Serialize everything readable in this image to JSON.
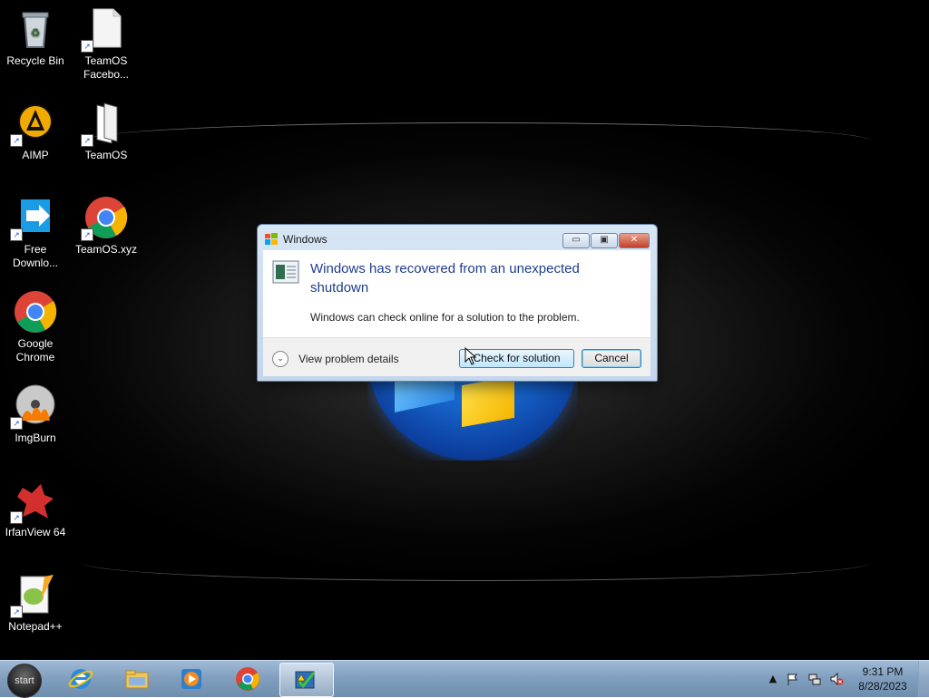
{
  "desktop": {
    "icons": [
      {
        "label": "Recycle Bin",
        "icon": "recycle-bin-icon"
      },
      {
        "label": "TeamOS Facebo...",
        "icon": "document-icon"
      },
      {
        "label": "AIMP",
        "icon": "aimp-icon"
      },
      {
        "label": "TeamOS",
        "icon": "document-icon"
      },
      {
        "label": "Free Downlo...",
        "icon": "download-manager-icon"
      },
      {
        "label": "TeamOS.xyz",
        "icon": "chrome-icon"
      },
      {
        "label": "Google Chrome",
        "icon": "chrome-icon"
      },
      {
        "label": "ImgBurn",
        "icon": "imgburn-icon"
      },
      {
        "label": "IrfanView 64",
        "icon": "irfanview-icon"
      },
      {
        "label": "Notepad++",
        "icon": "notepad-plus-plus-icon"
      }
    ]
  },
  "dialog": {
    "title": "Windows",
    "heading": "Windows has recovered from an unexpected shutdown",
    "message": "Windows can check online for a solution to the problem.",
    "details_label": "View problem details",
    "check_button": "Check for solution",
    "cancel_button": "Cancel",
    "minimize": "▭",
    "maximize": "▣",
    "close": "✕"
  },
  "taskbar": {
    "start_label": "start",
    "apps": [
      "internet-explorer-icon",
      "file-explorer-icon",
      "media-player-icon",
      "chrome-icon",
      "problem-reports-icon"
    ],
    "tray": {
      "show_hidden": "▲",
      "time": "9:31 PM",
      "date": "8/28/2023"
    }
  },
  "colors": {
    "dialog_heading": "#1e3e8c",
    "taskbar": "#7f9dbd"
  }
}
